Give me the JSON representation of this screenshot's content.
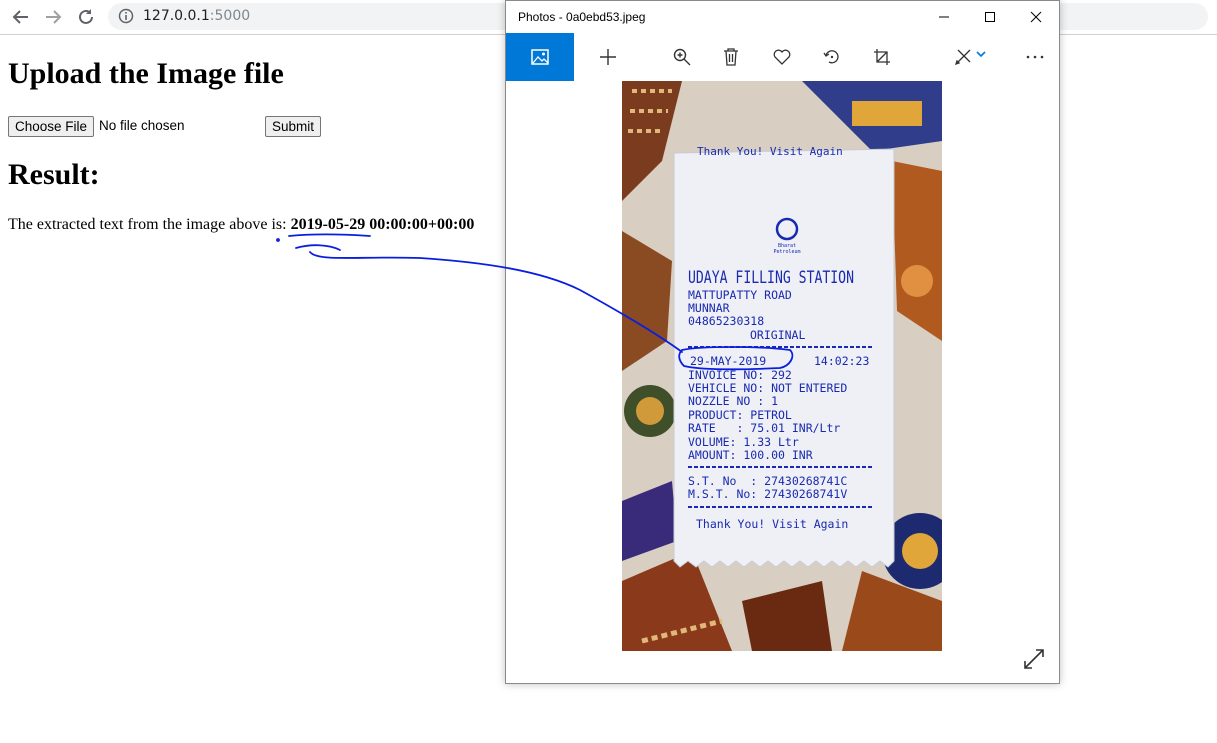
{
  "browser": {
    "url_host": "127.0.0.1",
    "url_port": ":5000",
    "back_icon": "arrow-left-icon",
    "forward_icon": "arrow-right-icon",
    "reload_icon": "reload-icon",
    "info_icon": "info-icon"
  },
  "page": {
    "title": "Upload the Image file",
    "choose_file_label": "Choose File",
    "file_status": "No file chosen",
    "submit_label": "Submit",
    "result_heading": "Result:",
    "result_prefix": "The extracted text from the image above is: ",
    "result_value": "2019-05-29 00:00:00+00:00"
  },
  "photos_window": {
    "title": "Photos - 0a0ebd53.jpeg",
    "toolbar": [
      "image-icon",
      "add-icon",
      "zoom-in-icon",
      "delete-icon",
      "favorite-icon",
      "rotate-icon",
      "crop-icon",
      "edit-icon",
      "more-icon"
    ],
    "accent": "#0078d7",
    "receipt": {
      "top_cut": "Thank You! Visit Again",
      "logo_line1": "Bharat",
      "logo_line2": "Petroleum",
      "station": "UDAYA FILLING STATION",
      "address1": "MATTUPATTY ROAD",
      "address2": "MUNNAR",
      "phone": "04865230318",
      "copy": "ORIGINAL",
      "date": "29-MAY-2019",
      "time": "14:02:23",
      "invoice": "INVOICE NO: 292",
      "vehicle": "VEHICLE NO: NOT ENTERED",
      "nozzle": "NOZZLE NO : 1",
      "product": "PRODUCT: PETROL",
      "rate": "RATE   : 75.01 INR/Ltr",
      "volume": "VOLUME: 1.33 Ltr",
      "amount": "AMOUNT: 100.00 INR",
      "st": "S.T. No  : 27430268741C",
      "mst": "M.S.T. No: 27430268741V",
      "thanks": "Thank You! Visit Again"
    }
  },
  "annotation_color": "#0a1ee0"
}
